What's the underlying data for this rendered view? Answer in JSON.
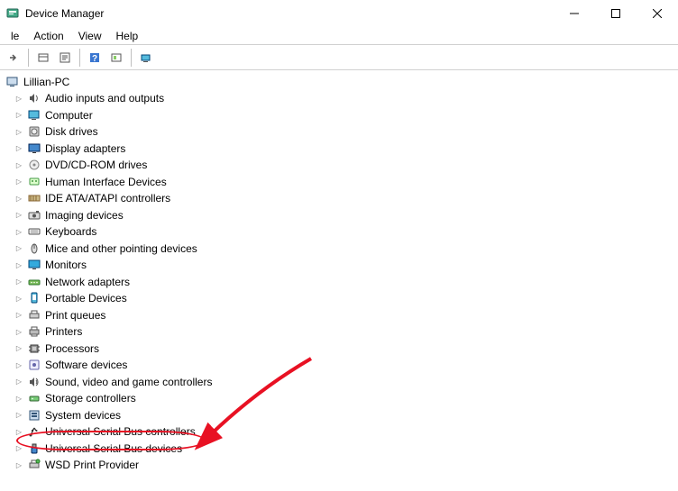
{
  "titlebar": {
    "title": "Device Manager"
  },
  "menubar": {
    "items": [
      "le",
      "Action",
      "View",
      "Help"
    ]
  },
  "tree": {
    "root": "Lillian-PC",
    "items": [
      {
        "label": "Audio inputs and outputs",
        "icon": "audio"
      },
      {
        "label": "Computer",
        "icon": "computer"
      },
      {
        "label": "Disk drives",
        "icon": "disk"
      },
      {
        "label": "Display adapters",
        "icon": "display"
      },
      {
        "label": "DVD/CD-ROM drives",
        "icon": "dvd"
      },
      {
        "label": "Human Interface Devices",
        "icon": "hid"
      },
      {
        "label": "IDE ATA/ATAPI controllers",
        "icon": "ide"
      },
      {
        "label": "Imaging devices",
        "icon": "imaging"
      },
      {
        "label": "Keyboards",
        "icon": "keyboard"
      },
      {
        "label": "Mice and other pointing devices",
        "icon": "mouse"
      },
      {
        "label": "Monitors",
        "icon": "monitor"
      },
      {
        "label": "Network adapters",
        "icon": "network"
      },
      {
        "label": "Portable Devices",
        "icon": "portable"
      },
      {
        "label": "Print queues",
        "icon": "printq"
      },
      {
        "label": "Printers",
        "icon": "printer"
      },
      {
        "label": "Processors",
        "icon": "cpu"
      },
      {
        "label": "Software devices",
        "icon": "software"
      },
      {
        "label": "Sound, video and game controllers",
        "icon": "sound"
      },
      {
        "label": "Storage controllers",
        "icon": "storage"
      },
      {
        "label": "System devices",
        "icon": "system"
      },
      {
        "label": "Universal Serial Bus controllers",
        "icon": "usb",
        "highlighted": true
      },
      {
        "label": "Universal Serial Bus devices",
        "icon": "usbdev"
      },
      {
        "label": "WSD Print Provider",
        "icon": "wsd"
      }
    ]
  },
  "annotation": {
    "type": "red-circle-and-arrow",
    "target": "Universal Serial Bus controllers"
  }
}
